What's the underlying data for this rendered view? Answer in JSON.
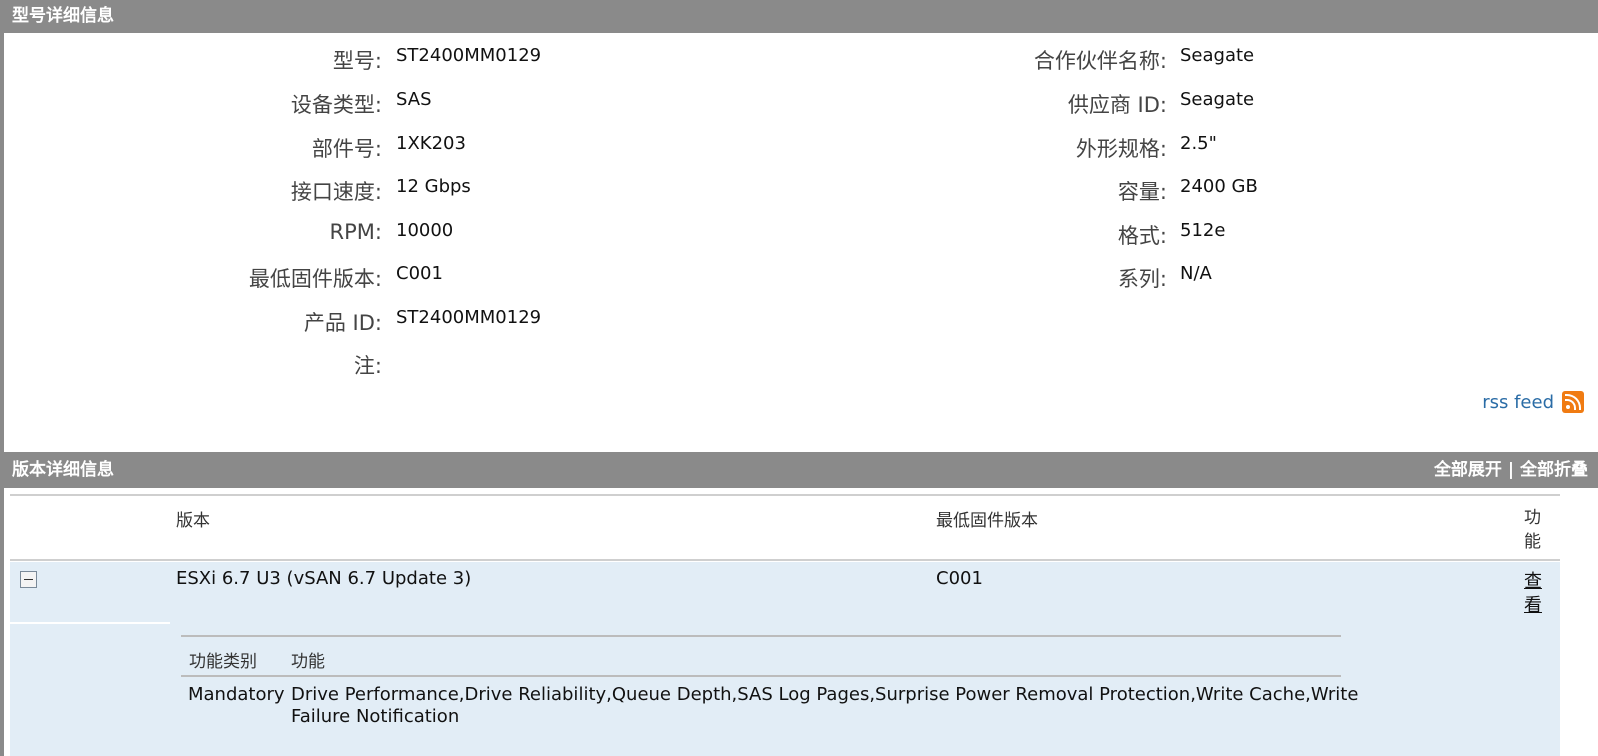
{
  "model_section": {
    "title": "型号详细信息",
    "left": [
      {
        "label": "型号:",
        "value": "ST2400MM0129"
      },
      {
        "label": "设备类型:",
        "value": "SAS"
      },
      {
        "label": "部件号:",
        "value": "1XK203"
      },
      {
        "label": "接口速度:",
        "value": "12 Gbps"
      },
      {
        "label": "RPM:",
        "value": "10000"
      },
      {
        "label": "最低固件版本:",
        "value": "C001"
      },
      {
        "label": "产品 ID:",
        "value": "ST2400MM0129"
      },
      {
        "label": "注:",
        "value": ""
      }
    ],
    "right": [
      {
        "label": "合作伙伴名称:",
        "value": "Seagate"
      },
      {
        "label": "供应商 ID:",
        "value": "Seagate"
      },
      {
        "label": "外形规格:",
        "value": "2.5\""
      },
      {
        "label": "容量:",
        "value": "2400 GB"
      },
      {
        "label": "格式:",
        "value": "512e"
      },
      {
        "label": "系列:",
        "value": "N/A"
      }
    ],
    "rss_label": "rss feed",
    "rss_icon": "rss-icon"
  },
  "release_section": {
    "title": "版本详细信息",
    "expand_all": "全部展开",
    "separator": "|",
    "collapse_all": "全部折叠",
    "columns": {
      "release": "版本",
      "min_firmware": "最低固件版本",
      "features": "功能"
    },
    "rows": [
      {
        "release": "ESXi 6.7 U3 (vSAN 6.7 Update 3)",
        "min_firmware": "C001",
        "view": "查看",
        "sub_table": {
          "columns": {
            "category": "功能类别",
            "features": "功能"
          },
          "rows": [
            {
              "category": "Mandatory",
              "features_line1": "Drive Performance,Drive Reliability,Queue Depth,SAS Log Pages,Surprise Power Removal Protection,Write Cache,Write",
              "features_line2": "Failure Notification"
            }
          ]
        }
      }
    ]
  },
  "colors": {
    "bar": "#8a8a8a",
    "row_highlight": "#e2edf6",
    "link": "#2a6ca6",
    "rss": "#f07b12"
  }
}
